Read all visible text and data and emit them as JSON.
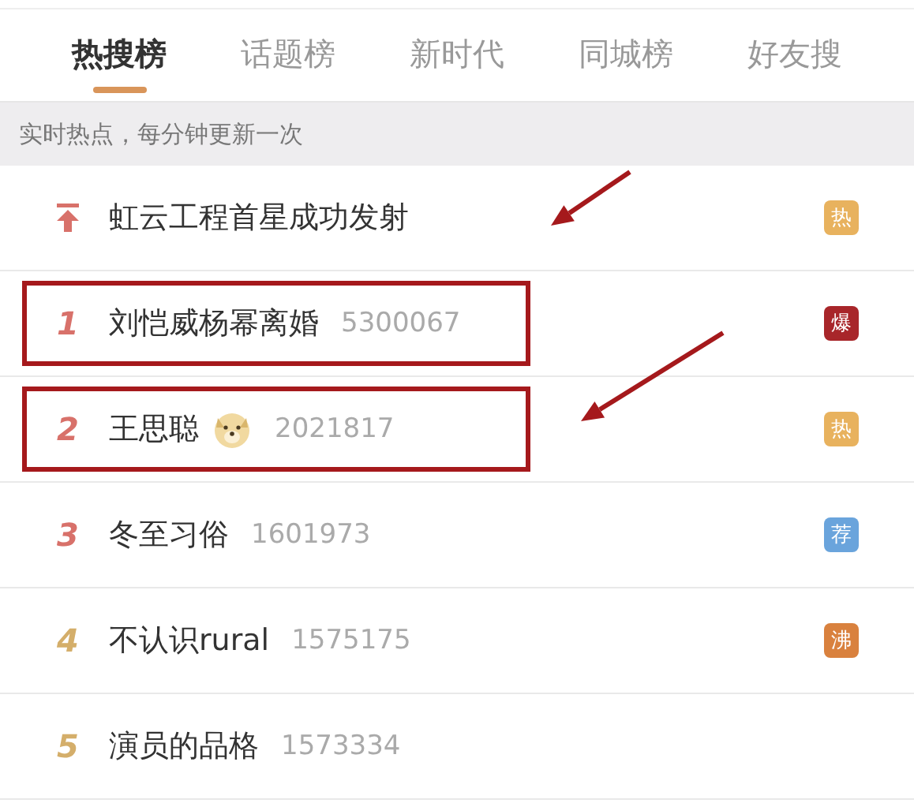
{
  "tabs": [
    {
      "label": "热搜榜",
      "selected": true
    },
    {
      "label": "话题榜",
      "selected": false
    },
    {
      "label": "新时代",
      "selected": false
    },
    {
      "label": "同城榜",
      "selected": false
    },
    {
      "label": "好友搜",
      "selected": false
    }
  ],
  "subtitle": "实时热点，每分钟更新一次",
  "rows": [
    {
      "kind": "pinned",
      "title": "虹云工程首星成功发射",
      "badge": "热",
      "color": "#e8b25e",
      "highlighted": false,
      "arrow": true,
      "emoji": false
    },
    {
      "kind": "ranked",
      "rank": "1",
      "title": "刘恺威杨幂离婚",
      "count": "5300067",
      "badge": "爆",
      "color": "#a8262a",
      "highlighted": true,
      "arrow": false,
      "emoji": false
    },
    {
      "kind": "ranked",
      "rank": "2",
      "title": "王思聪",
      "count": "2021817",
      "badge": "热",
      "color": "#e8b25e",
      "highlighted": true,
      "arrow": true,
      "emoji": true
    },
    {
      "kind": "ranked",
      "rank": "3",
      "title": "冬至习俗",
      "count": "1601973",
      "badge": "荐",
      "color": "#6aa4dc",
      "highlighted": false,
      "arrow": false,
      "emoji": false
    },
    {
      "kind": "ranked",
      "rank": "4",
      "title": "不认识rural",
      "count": "1575175",
      "badge": "沸",
      "color": "#d9813e",
      "highlighted": false,
      "arrow": false,
      "emoji": false
    },
    {
      "kind": "ranked",
      "rank": "5",
      "title": "演员的品格",
      "count": "1573334",
      "highlighted": false,
      "arrow": false,
      "emoji": false
    }
  ]
}
